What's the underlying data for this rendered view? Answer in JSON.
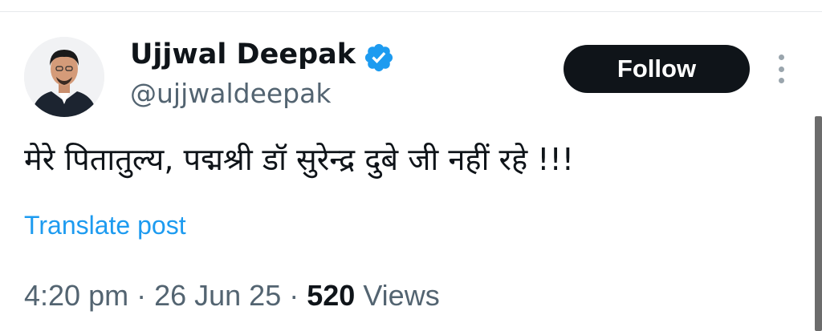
{
  "author": {
    "display_name": "Ujjwal Deepak",
    "handle": "@ujjwaldeepak",
    "verified": true
  },
  "follow_label": "Follow",
  "tweet": {
    "text": "मेरे पितातुल्य, पद्मश्री डॉ सुरेन्द्र दुबे जी नहीं रहे !!!",
    "translate_label": "Translate post"
  },
  "meta": {
    "time": "4:20 pm",
    "separator": " · ",
    "date": "26 Jun 25",
    "views_count": "520",
    "views_label": "Views"
  },
  "icons": {
    "verified": "verified-badge-icon",
    "more": "more-vertical-icon",
    "avatar": "profile-avatar"
  },
  "colors": {
    "link": "#1d9bf0",
    "secondary_text": "#536471",
    "follow_bg": "#0f1419",
    "verified": "#1d9bf0"
  }
}
